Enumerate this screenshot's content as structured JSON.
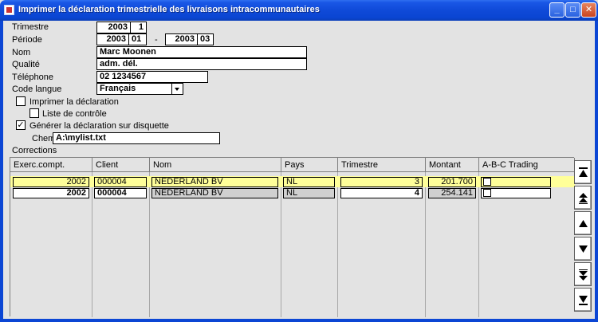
{
  "window": {
    "title": "Imprimer la déclaration trimestrielle des livraisons intracommunautaires",
    "minimize_glyph": "_",
    "maximize_glyph": "□",
    "close_glyph": "✕"
  },
  "form": {
    "trimestre": {
      "label": "Trimestre",
      "year": "2003",
      "quarter": "1"
    },
    "periode": {
      "label": "Période",
      "from_year": "2003",
      "from_month": "01",
      "separator": "-",
      "to_year": "2003",
      "to_month": "03"
    },
    "nom": {
      "label": "Nom",
      "value": "Marc Moonen"
    },
    "qualite": {
      "label": "Qualité",
      "value": "adm. dél."
    },
    "telephone": {
      "label": "Téléphone",
      "value": "02 1234567"
    },
    "code_langue": {
      "label": "Code langue",
      "value": "Français"
    },
    "imprimer_declaration": {
      "label": "Imprimer la déclaration",
      "checked": false
    },
    "liste_controle": {
      "label": "Liste de contrôle",
      "checked": false
    },
    "generer_disquette": {
      "label": "Générer la déclaration sur disquette",
      "checked": true,
      "check_glyph": "✓"
    },
    "chemin": {
      "label": "Chem",
      "value": "A:\\mylist.txt"
    }
  },
  "corrections": {
    "label": "Corrections",
    "columns": [
      "Exerc.compt.",
      "Client",
      "Nom",
      "Pays",
      "Trimestre",
      "Montant",
      "A-B-C Trading"
    ],
    "rows": [
      {
        "exercice": "2002",
        "client": "000004",
        "nom": "NEDERLAND BV",
        "pays": "NL",
        "trimestre": "3",
        "montant": "201.700",
        "abc": false
      },
      {
        "exercice": "2002",
        "client": "000004",
        "nom": "NEDERLAND BV",
        "pays": "NL",
        "trimestre": "4",
        "montant": "254.141",
        "abc": false
      }
    ]
  },
  "scroll_buttons": [
    "scroll-top",
    "page-up",
    "line-up",
    "line-down",
    "page-down",
    "scroll-bottom"
  ]
}
